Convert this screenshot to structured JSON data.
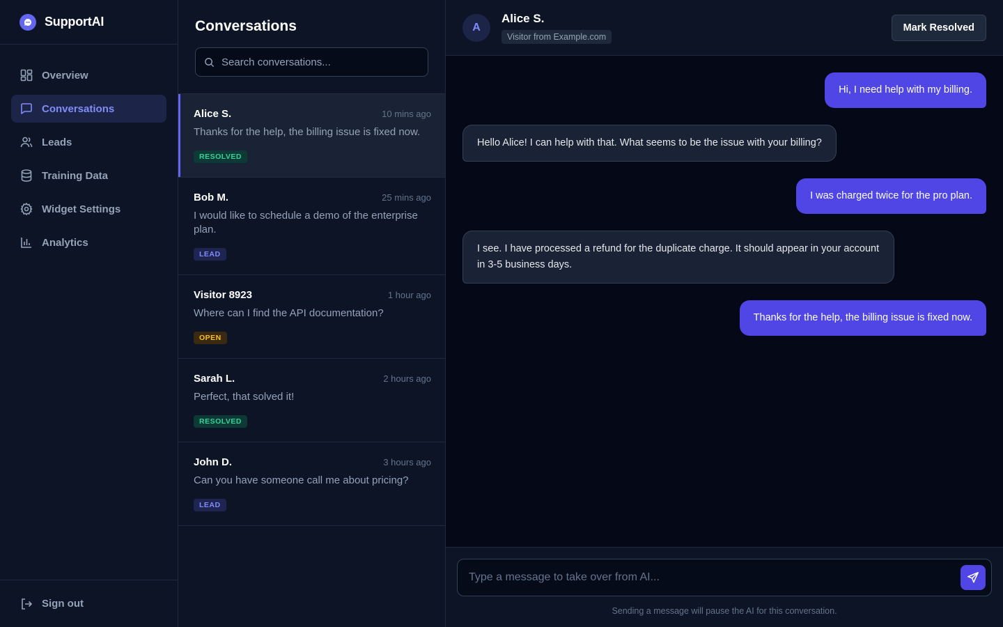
{
  "brand": {
    "name": "SupportAI"
  },
  "nav": {
    "items": [
      {
        "label": "Overview",
        "icon": "grid-icon",
        "active": false
      },
      {
        "label": "Conversations",
        "icon": "chat-icon",
        "active": true
      },
      {
        "label": "Leads",
        "icon": "users-icon",
        "active": false
      },
      {
        "label": "Training Data",
        "icon": "database-icon",
        "active": false
      },
      {
        "label": "Widget Settings",
        "icon": "gear-icon",
        "active": false
      },
      {
        "label": "Analytics",
        "icon": "bar-chart-icon",
        "active": false
      }
    ],
    "signout_label": "Sign out"
  },
  "conversations": {
    "title": "Conversations",
    "search_placeholder": "Search conversations...",
    "items": [
      {
        "name": "Alice S.",
        "time": "10 mins ago",
        "snippet": "Thanks for the help, the billing issue is fixed now.",
        "status": "RESOLVED",
        "status_type": "resolved",
        "active": true
      },
      {
        "name": "Bob M.",
        "time": "25 mins ago",
        "snippet": "I would like to schedule a demo of the enterprise plan.",
        "status": "LEAD",
        "status_type": "lead",
        "active": false
      },
      {
        "name": "Visitor 8923",
        "time": "1 hour ago",
        "snippet": "Where can I find the API documentation?",
        "status": "OPEN",
        "status_type": "open",
        "active": false
      },
      {
        "name": "Sarah L.",
        "time": "2 hours ago",
        "snippet": "Perfect, that solved it!",
        "status": "RESOLVED",
        "status_type": "resolved",
        "active": false
      },
      {
        "name": "John D.",
        "time": "3 hours ago",
        "snippet": "Can you have someone call me about pricing?",
        "status": "LEAD",
        "status_type": "lead",
        "active": false
      }
    ]
  },
  "chat": {
    "avatar_initial": "A",
    "name": "Alice S.",
    "subtitle": "Visitor from Example.com",
    "mark_resolved_label": "Mark Resolved",
    "messages": [
      {
        "role": "user",
        "text": "Hi, I need help with my billing."
      },
      {
        "role": "bot",
        "text": "Hello Alice! I can help with that. What seems to be the issue with your billing?"
      },
      {
        "role": "user",
        "text": "I was charged twice for the pro plan."
      },
      {
        "role": "bot",
        "text": "I see. I have processed a refund for the duplicate charge. It should appear in your account in 3-5 business days."
      },
      {
        "role": "user",
        "text": "Thanks for the help, the billing issue is fixed now."
      }
    ],
    "composer_placeholder": "Type a message to take over from AI...",
    "composer_note": "Sending a message will pause the AI for this conversation."
  },
  "colors": {
    "accent": "#6366f1",
    "resolved": "#34d399",
    "lead": "#818cf8",
    "open": "#fbbf24"
  }
}
